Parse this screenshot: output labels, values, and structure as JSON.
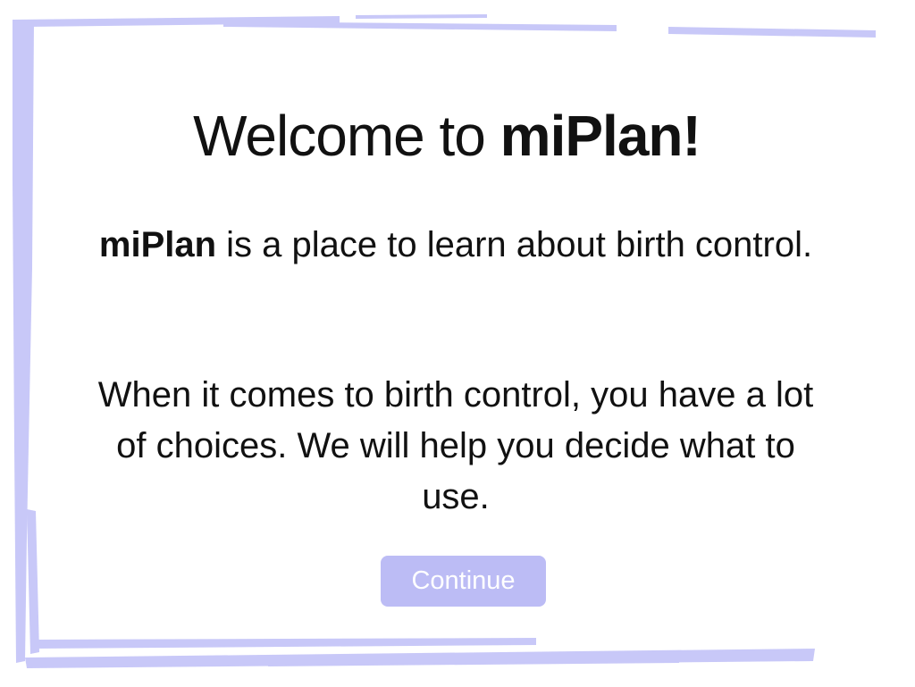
{
  "welcome": {
    "prefix": "Welcome to ",
    "brand": "miPlan!"
  },
  "intro": {
    "brand": "miPlan",
    "rest": " is a place to learn about birth control."
  },
  "choices": {
    "text": "When it comes to birth control, you have a lot of choices. We will help you decide what to use."
  },
  "continue_button": {
    "label": "Continue"
  },
  "colors": {
    "frame": "#c8c8f8",
    "button_bg": "#bcbcf5",
    "button_text": "#ffffff"
  }
}
